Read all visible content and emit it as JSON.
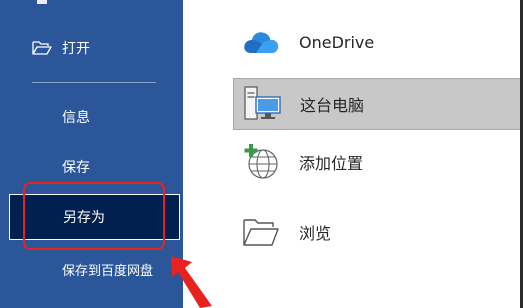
{
  "sidebar": {
    "open_label": "打开",
    "info_label": "信息",
    "save_label": "保存",
    "save_as_label": "另存为",
    "save_to_baidu_label": "保存到百度网盘"
  },
  "locations": {
    "onedrive_label": "OneDrive",
    "this_pc_label": "这台电脑",
    "add_place_label": "添加位置",
    "browse_label": "浏览"
  },
  "icons": {
    "open": "folder-open-icon",
    "onedrive": "cloud-icon",
    "this_pc": "computer-icon",
    "add_place": "globe-plus-icon",
    "browse": "folder-icon"
  },
  "colors": {
    "sidebar_bg": "#2b579a",
    "selected_bg": "#002050",
    "annotation_red": "#e8231f",
    "onedrive_blue": "#1f6fc5"
  }
}
